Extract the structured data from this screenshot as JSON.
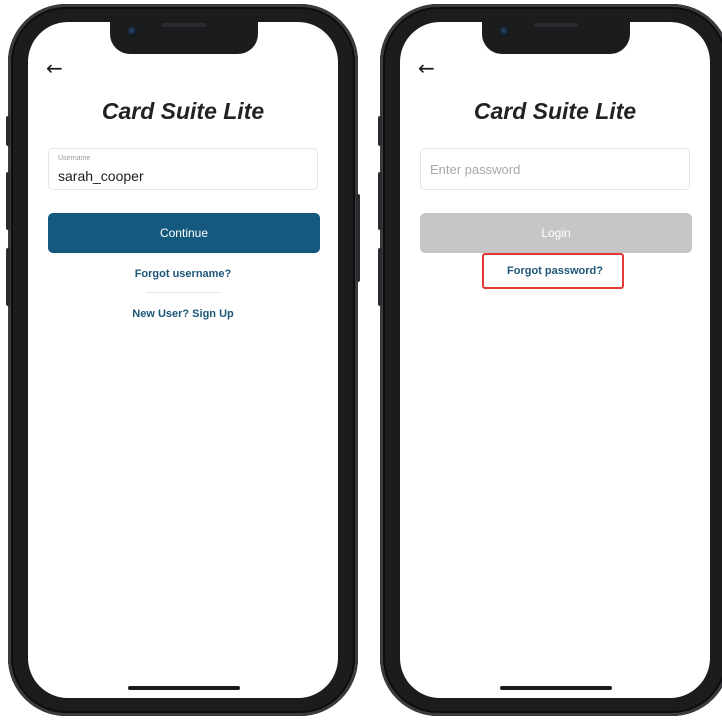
{
  "left_screen": {
    "back_icon": "arrow-left-icon",
    "app_title": "Card Suite Lite",
    "username_label": "Username",
    "username_value": "sarah_cooper",
    "continue_label": "Continue",
    "forgot_username": "Forgot username?",
    "signup": "New User? Sign Up"
  },
  "right_screen": {
    "back_icon": "arrow-left-icon",
    "app_title": "Card Suite Lite",
    "password_placeholder": "Enter password",
    "login_label": "Login",
    "forgot_password": "Forgot password?"
  },
  "colors": {
    "primary": "#155a7e",
    "link": "#1b5677",
    "disabled": "#c6c6c6",
    "highlight": "#e53935"
  }
}
